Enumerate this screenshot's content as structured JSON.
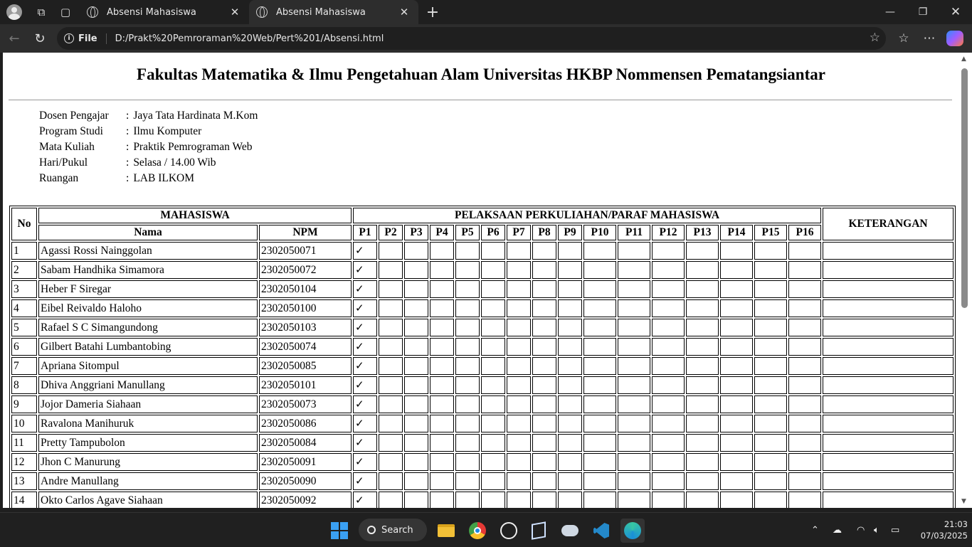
{
  "browser": {
    "tabs": [
      {
        "label": "Absensi Mahasiswa",
        "active": false
      },
      {
        "label": "Absensi Mahasiswa",
        "active": true
      }
    ],
    "address": {
      "scheme_label": "File",
      "url": "D:/Prakt%20Pemroraman%20Web/Pert%201/Absensi.html"
    }
  },
  "page": {
    "heading": "Fakultas Matematika & Ilmu Pengetahuan Alam Universitas HKBP Nommensen Pematangsiantar",
    "info": [
      {
        "label": "Dosen Pengajar",
        "sep": ":",
        "value": "Jaya Tata Hardinata M.Kom"
      },
      {
        "label": "Program Studi",
        "sep": ":",
        "value": "Ilmu Komputer"
      },
      {
        "label": "Mata Kuliah",
        "sep": ":",
        "value": "Praktik Pemrograman Web"
      },
      {
        "label": "Hari/Pukul",
        "sep": ":",
        "value": "Selasa / 14.00 Wib"
      },
      {
        "label": "Ruangan",
        "sep": ":",
        "value": "LAB ILKOM"
      }
    ],
    "table": {
      "col_no": "No",
      "col_mahasiswa": "MAHASISWA",
      "col_nama": "Nama",
      "col_npm": "NPM",
      "col_pelaksanaan": "PELAKSAAN PERKULIAHAN/PARAF MAHASISWA",
      "col_keterangan": "KETERANGAN",
      "sessions": [
        "P1",
        "P2",
        "P3",
        "P4",
        "P5",
        "P6",
        "P7",
        "P8",
        "P9",
        "P10",
        "P11",
        "P12",
        "P13",
        "P14",
        "P15",
        "P16"
      ],
      "check_mark": "✓",
      "rows": [
        {
          "no": "1",
          "nama": "Agassi Rossi Nainggolan",
          "npm": "2302050071",
          "p1": true
        },
        {
          "no": "2",
          "nama": "Sabam Handhika Simamora",
          "npm": "2302050072",
          "p1": true
        },
        {
          "no": "3",
          "nama": "Heber F Siregar",
          "npm": "2302050104",
          "p1": true
        },
        {
          "no": "4",
          "nama": "Eibel Reivaldo Haloho",
          "npm": "2302050100",
          "p1": true
        },
        {
          "no": "5",
          "nama": "Rafael S C Simangundong",
          "npm": "2302050103",
          "p1": true
        },
        {
          "no": "6",
          "nama": "Gilbert Batahi Lumbantobing",
          "npm": "2302050074",
          "p1": true
        },
        {
          "no": "7",
          "nama": "Apriana Sitompul",
          "npm": "2302050085",
          "p1": true
        },
        {
          "no": "8",
          "nama": "Dhiva Anggriani Manullang",
          "npm": "2302050101",
          "p1": true
        },
        {
          "no": "9",
          "nama": "Jojor Dameria Siahaan",
          "npm": "2302050073",
          "p1": true
        },
        {
          "no": "10",
          "nama": "Ravalona Manihuruk",
          "npm": "2302050086",
          "p1": true
        },
        {
          "no": "11",
          "nama": "Pretty Tampubolon",
          "npm": "2302050084",
          "p1": true
        },
        {
          "no": "12",
          "nama": "Jhon C Manurung",
          "npm": "2302050091",
          "p1": true
        },
        {
          "no": "13",
          "nama": "Andre Manullang",
          "npm": "2302050090",
          "p1": true
        },
        {
          "no": "14",
          "nama": "Okto Carlos Agave Siahaan",
          "npm": "2302050092",
          "p1": true
        }
      ]
    }
  },
  "taskbar": {
    "search_label": "Search",
    "apps": [
      "windows-start-icon",
      "file-explorer-icon",
      "chrome-icon",
      "whatsapp-icon",
      "virtualbox-icon",
      "app-icon",
      "vscode-icon",
      "edge-icon"
    ],
    "time": "21:03",
    "date": "07/03/2025"
  }
}
